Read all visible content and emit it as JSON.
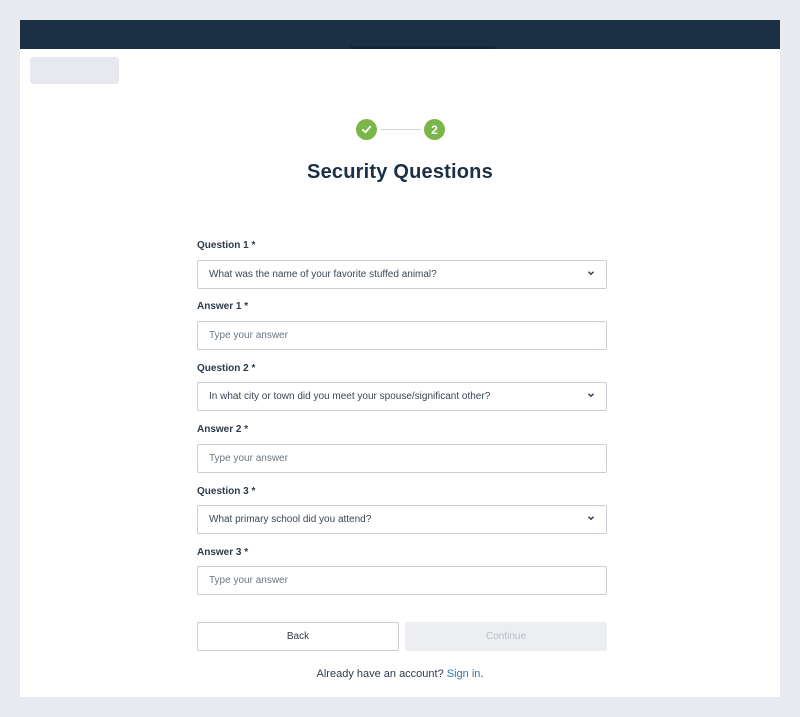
{
  "stepper": {
    "step1_state": "completed",
    "step2_label": "2",
    "accent_color": "#7ab648"
  },
  "page": {
    "title": "Security Questions"
  },
  "form": {
    "question1": {
      "label": "Question 1 *",
      "value": "What was the name of your favorite stuffed animal?"
    },
    "answer1": {
      "label": "Answer 1 *",
      "placeholder": "Type your answer"
    },
    "question2": {
      "label": "Question 2 *",
      "value": "In what city or town did you meet your spouse/significant other?"
    },
    "answer2": {
      "label": "Answer 2 *",
      "placeholder": "Type your answer"
    },
    "question3": {
      "label": "Question 3 *",
      "value": "What primary school did you attend?"
    },
    "answer3": {
      "label": "Answer 3 *",
      "placeholder": "Type your answer"
    }
  },
  "buttons": {
    "back": "Back",
    "continue": "Continue"
  },
  "footer": {
    "prompt": "Already have an account?",
    "link": "Sign in",
    "suffix": "."
  },
  "colors": {
    "header": "#1b3044",
    "link": "#2a7ab8"
  }
}
